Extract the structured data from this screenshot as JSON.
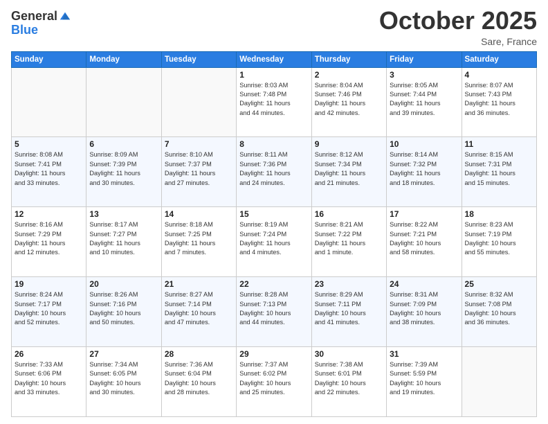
{
  "header": {
    "logo_line1": "General",
    "logo_line2": "Blue",
    "month": "October 2025",
    "location": "Sare, France"
  },
  "weekdays": [
    "Sunday",
    "Monday",
    "Tuesday",
    "Wednesday",
    "Thursday",
    "Friday",
    "Saturday"
  ],
  "weeks": [
    [
      {
        "day": "",
        "info": ""
      },
      {
        "day": "",
        "info": ""
      },
      {
        "day": "",
        "info": ""
      },
      {
        "day": "1",
        "info": "Sunrise: 8:03 AM\nSunset: 7:48 PM\nDaylight: 11 hours\nand 44 minutes."
      },
      {
        "day": "2",
        "info": "Sunrise: 8:04 AM\nSunset: 7:46 PM\nDaylight: 11 hours\nand 42 minutes."
      },
      {
        "day": "3",
        "info": "Sunrise: 8:05 AM\nSunset: 7:44 PM\nDaylight: 11 hours\nand 39 minutes."
      },
      {
        "day": "4",
        "info": "Sunrise: 8:07 AM\nSunset: 7:43 PM\nDaylight: 11 hours\nand 36 minutes."
      }
    ],
    [
      {
        "day": "5",
        "info": "Sunrise: 8:08 AM\nSunset: 7:41 PM\nDaylight: 11 hours\nand 33 minutes."
      },
      {
        "day": "6",
        "info": "Sunrise: 8:09 AM\nSunset: 7:39 PM\nDaylight: 11 hours\nand 30 minutes."
      },
      {
        "day": "7",
        "info": "Sunrise: 8:10 AM\nSunset: 7:37 PM\nDaylight: 11 hours\nand 27 minutes."
      },
      {
        "day": "8",
        "info": "Sunrise: 8:11 AM\nSunset: 7:36 PM\nDaylight: 11 hours\nand 24 minutes."
      },
      {
        "day": "9",
        "info": "Sunrise: 8:12 AM\nSunset: 7:34 PM\nDaylight: 11 hours\nand 21 minutes."
      },
      {
        "day": "10",
        "info": "Sunrise: 8:14 AM\nSunset: 7:32 PM\nDaylight: 11 hours\nand 18 minutes."
      },
      {
        "day": "11",
        "info": "Sunrise: 8:15 AM\nSunset: 7:31 PM\nDaylight: 11 hours\nand 15 minutes."
      }
    ],
    [
      {
        "day": "12",
        "info": "Sunrise: 8:16 AM\nSunset: 7:29 PM\nDaylight: 11 hours\nand 12 minutes."
      },
      {
        "day": "13",
        "info": "Sunrise: 8:17 AM\nSunset: 7:27 PM\nDaylight: 11 hours\nand 10 minutes."
      },
      {
        "day": "14",
        "info": "Sunrise: 8:18 AM\nSunset: 7:25 PM\nDaylight: 11 hours\nand 7 minutes."
      },
      {
        "day": "15",
        "info": "Sunrise: 8:19 AM\nSunset: 7:24 PM\nDaylight: 11 hours\nand 4 minutes."
      },
      {
        "day": "16",
        "info": "Sunrise: 8:21 AM\nSunset: 7:22 PM\nDaylight: 11 hours\nand 1 minute."
      },
      {
        "day": "17",
        "info": "Sunrise: 8:22 AM\nSunset: 7:21 PM\nDaylight: 10 hours\nand 58 minutes."
      },
      {
        "day": "18",
        "info": "Sunrise: 8:23 AM\nSunset: 7:19 PM\nDaylight: 10 hours\nand 55 minutes."
      }
    ],
    [
      {
        "day": "19",
        "info": "Sunrise: 8:24 AM\nSunset: 7:17 PM\nDaylight: 10 hours\nand 52 minutes."
      },
      {
        "day": "20",
        "info": "Sunrise: 8:26 AM\nSunset: 7:16 PM\nDaylight: 10 hours\nand 50 minutes."
      },
      {
        "day": "21",
        "info": "Sunrise: 8:27 AM\nSunset: 7:14 PM\nDaylight: 10 hours\nand 47 minutes."
      },
      {
        "day": "22",
        "info": "Sunrise: 8:28 AM\nSunset: 7:13 PM\nDaylight: 10 hours\nand 44 minutes."
      },
      {
        "day": "23",
        "info": "Sunrise: 8:29 AM\nSunset: 7:11 PM\nDaylight: 10 hours\nand 41 minutes."
      },
      {
        "day": "24",
        "info": "Sunrise: 8:31 AM\nSunset: 7:09 PM\nDaylight: 10 hours\nand 38 minutes."
      },
      {
        "day": "25",
        "info": "Sunrise: 8:32 AM\nSunset: 7:08 PM\nDaylight: 10 hours\nand 36 minutes."
      }
    ],
    [
      {
        "day": "26",
        "info": "Sunrise: 7:33 AM\nSunset: 6:06 PM\nDaylight: 10 hours\nand 33 minutes."
      },
      {
        "day": "27",
        "info": "Sunrise: 7:34 AM\nSunset: 6:05 PM\nDaylight: 10 hours\nand 30 minutes."
      },
      {
        "day": "28",
        "info": "Sunrise: 7:36 AM\nSunset: 6:04 PM\nDaylight: 10 hours\nand 28 minutes."
      },
      {
        "day": "29",
        "info": "Sunrise: 7:37 AM\nSunset: 6:02 PM\nDaylight: 10 hours\nand 25 minutes."
      },
      {
        "day": "30",
        "info": "Sunrise: 7:38 AM\nSunset: 6:01 PM\nDaylight: 10 hours\nand 22 minutes."
      },
      {
        "day": "31",
        "info": "Sunrise: 7:39 AM\nSunset: 5:59 PM\nDaylight: 10 hours\nand 19 minutes."
      },
      {
        "day": "",
        "info": ""
      }
    ]
  ]
}
